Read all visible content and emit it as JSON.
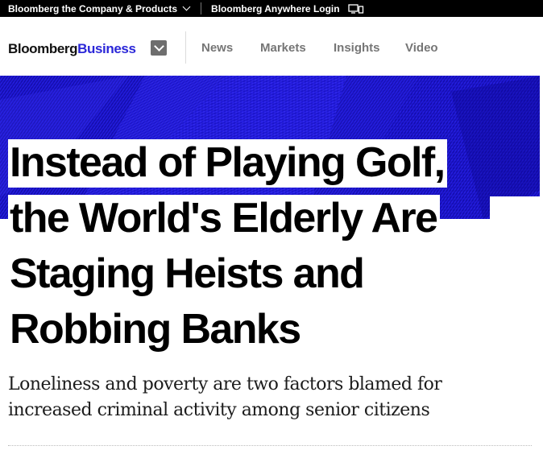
{
  "topbar": {
    "company_label": "Bloomberg the Company & Products",
    "anywhere_label": "Bloomberg Anywhere Login"
  },
  "nav": {
    "logo_part1": "Bloomberg",
    "logo_part2": "Business",
    "links": [
      "News",
      "Markets",
      "Insights",
      "Video"
    ]
  },
  "article": {
    "headline": "Instead of Playing Golf, the World's Elderly Are Staging Heists and Robbing Banks",
    "dek": "Loneliness and poverty are two factors blamed for increased criminal activity among senior citizens"
  },
  "colors": {
    "brand_blue": "#2b27d8",
    "hero_blue": "#1a12cf",
    "topbar_bg": "#000000",
    "nav_text": "#767676"
  },
  "icons": {
    "topbar_chevron": "chevron-down-icon",
    "anywhere": "monitor-icon",
    "menu": "menu-chevron-icon"
  }
}
